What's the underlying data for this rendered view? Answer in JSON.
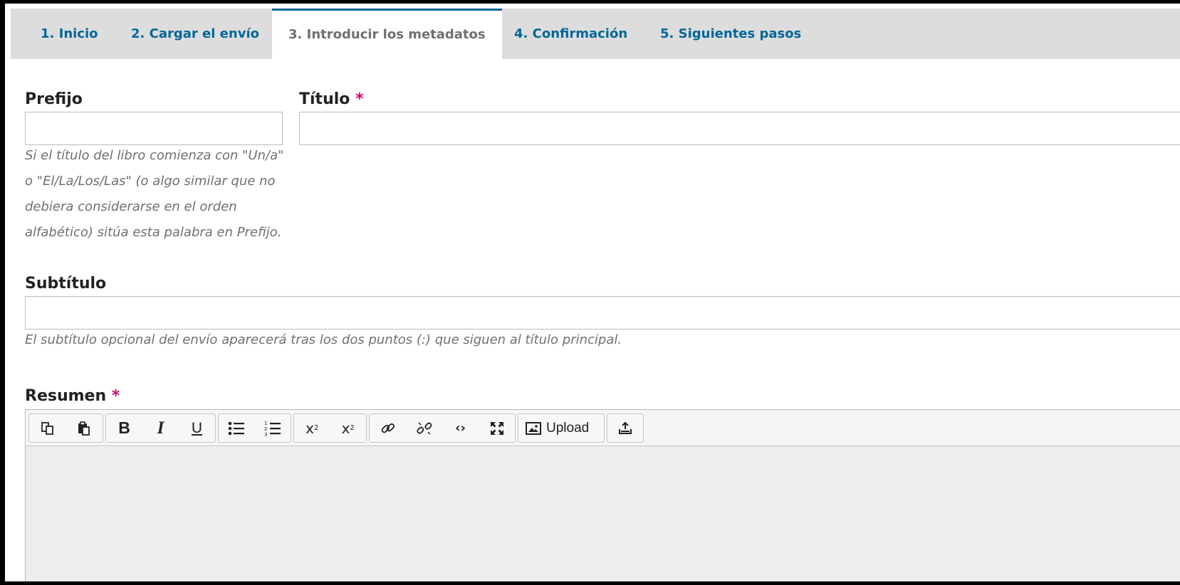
{
  "tabs": [
    {
      "label": "1. Inicio"
    },
    {
      "label": "2. Cargar el envío"
    },
    {
      "label": "3. Introducir los metadatos"
    },
    {
      "label": "4. Confirmación"
    },
    {
      "label": "5. Siguientes pasos"
    }
  ],
  "active_tab_index": 2,
  "form": {
    "prefix": {
      "label": "Prefijo",
      "value": "",
      "help_lines": [
        "Si el título del libro comienza con \"Un/a\"",
        "o \"El/La/Los/Las\" (o algo similar que no",
        "debiera considerarse en el orden",
        "alfabético) sitúa esta palabra en Prefijo."
      ]
    },
    "title": {
      "label": "Título",
      "required_mark": "*",
      "value": ""
    },
    "subtitle": {
      "label": "Subtítulo",
      "value": "",
      "help": "El subtítulo opcional del envío aparecerá tras los dos puntos (:) que siguen al título principal."
    },
    "abstract": {
      "label": "Resumen",
      "required_mark": "*"
    }
  },
  "editor_toolbar": {
    "upload_label": "Upload",
    "icons": [
      "copy-icon",
      "paste-icon",
      "bold-icon",
      "italic-icon",
      "underline-icon",
      "bullet-list-icon",
      "numbered-list-icon",
      "superscript-icon",
      "subscript-icon",
      "link-icon",
      "unlink-icon",
      "code-icon",
      "fullscreen-icon",
      "image-icon",
      "insert-icon"
    ]
  },
  "colors": {
    "link": "#006798",
    "required": "#d00a6c",
    "tab_bar": "#dddddd",
    "editor_bg": "#ededed"
  }
}
